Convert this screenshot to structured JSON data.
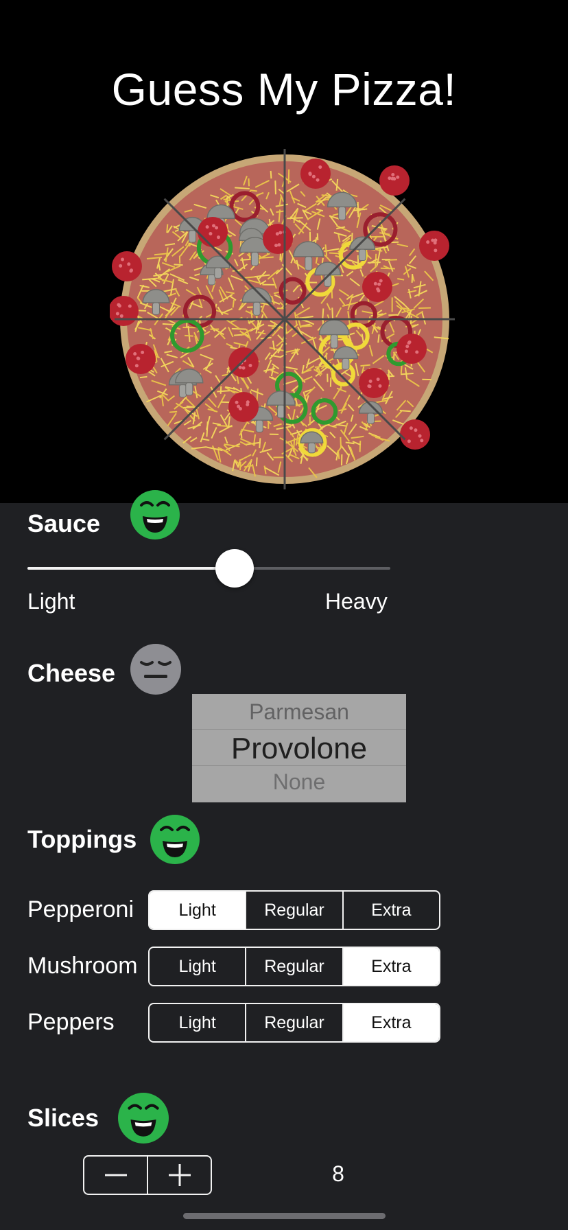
{
  "title": "Guess My Pizza!",
  "pizza": {
    "slices": 8,
    "toppings": [
      "pepperoni-icon",
      "mushroom-icon",
      "pepper-icon"
    ]
  },
  "sauce": {
    "title": "Sauce",
    "feedback": "happy",
    "min_label": "Light",
    "max_label": "Heavy",
    "level": 0.57
  },
  "cheese": {
    "title": "Cheese",
    "feedback": "neutral",
    "options_visible": [
      "Parmesan",
      "Provolone",
      "None"
    ],
    "selected": "Provolone"
  },
  "toppings": {
    "title": "Toppings",
    "feedback": "happy",
    "items": [
      {
        "label": "Pepperoni",
        "options": [
          "Light",
          "Regular",
          "Extra"
        ],
        "selected": "Light"
      },
      {
        "label": "Mushroom",
        "options": [
          "Light",
          "Regular",
          "Extra"
        ],
        "selected": "Extra"
      },
      {
        "label": "Peppers",
        "options": [
          "Light",
          "Regular",
          "Extra"
        ],
        "selected": "Extra"
      }
    ]
  },
  "slices": {
    "title": "Slices",
    "feedback": "happy",
    "value": "8",
    "decrement_icon": "minus-icon",
    "increment_icon": "plus-icon"
  },
  "colors": {
    "happy": "#2bb34a",
    "neutral": "#8e8e93",
    "background": "#1f2023",
    "header": "#000000"
  }
}
